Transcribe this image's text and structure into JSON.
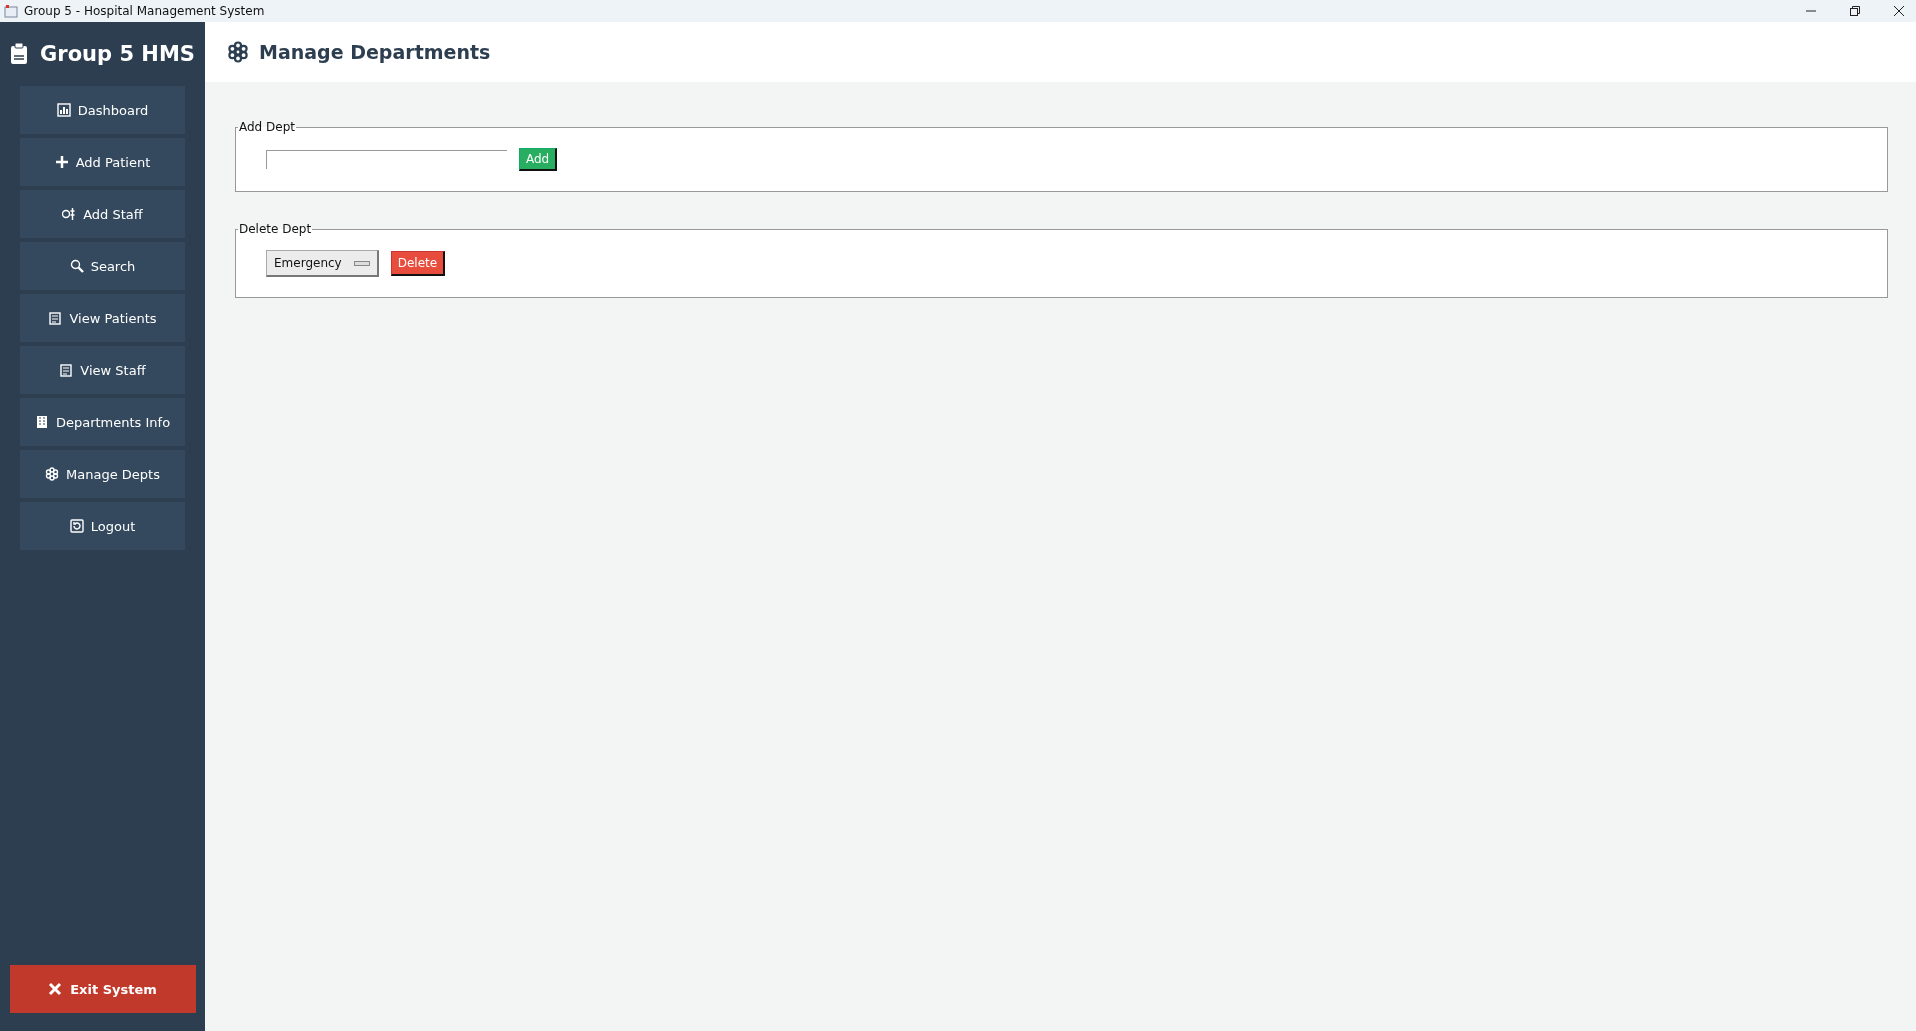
{
  "window": {
    "title": "Group 5 - Hospital Management System"
  },
  "sidebar": {
    "logo": "Group 5 HMS",
    "items": [
      {
        "label": "Dashboard",
        "kind": "chart"
      },
      {
        "label": "Add Patient",
        "kind": "plus"
      },
      {
        "label": "Add Staff",
        "kind": "staff"
      },
      {
        "label": "Search",
        "kind": "search"
      },
      {
        "label": "View Patients",
        "kind": "clipboard"
      },
      {
        "label": "View Staff",
        "kind": "clipboard"
      },
      {
        "label": "Departments Info",
        "kind": "building"
      },
      {
        "label": "Manage Depts",
        "kind": "gear"
      },
      {
        "label": "Logout",
        "kind": "logout"
      }
    ],
    "exit_button": "Exit System"
  },
  "header": {
    "title": "Manage Departments"
  },
  "add_section": {
    "legend": "Add Dept",
    "button": "Add"
  },
  "delete_section": {
    "legend": "Delete Dept",
    "selected_department": "Emergency",
    "button": "Delete"
  }
}
